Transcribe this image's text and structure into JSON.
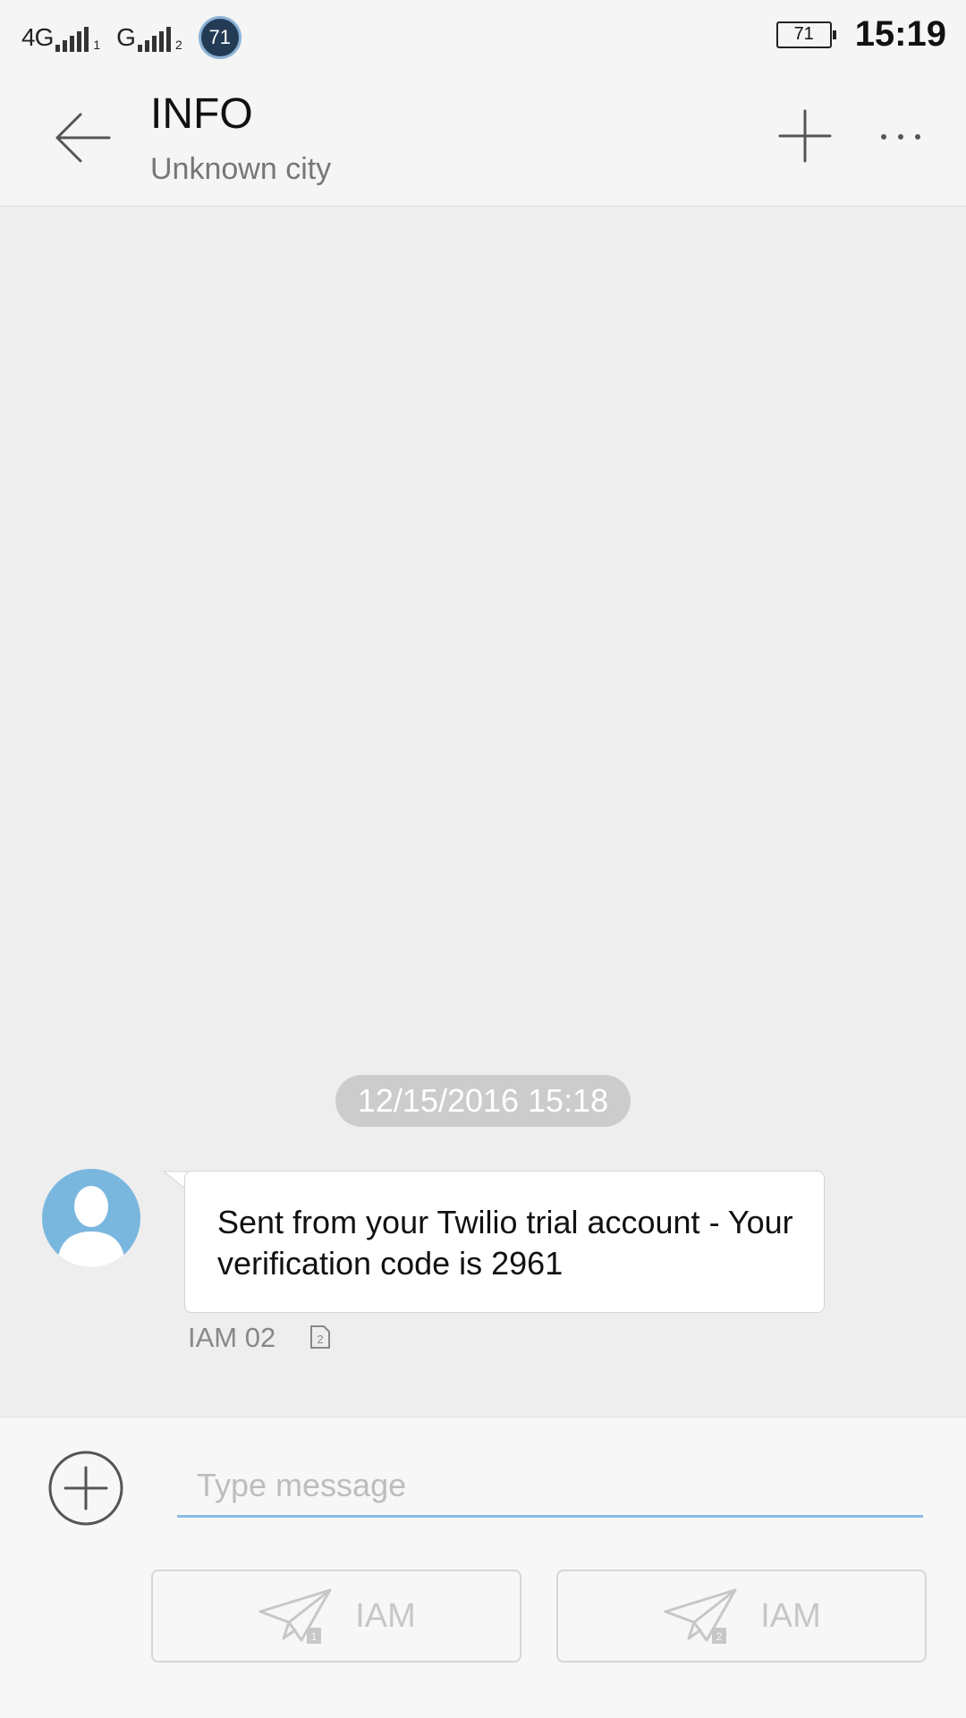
{
  "status_bar": {
    "sim1_network": "4G",
    "sim1_index": "1",
    "sim2_network": "G",
    "sim2_index": "2",
    "notification_badge": "71",
    "battery_level": "71",
    "time": "15:19"
  },
  "header": {
    "title": "INFO",
    "subtitle": "Unknown city",
    "icons": {
      "back": "back-arrow-icon",
      "add": "plus-icon",
      "more": "more-dots-icon"
    }
  },
  "conversation": {
    "timestamp": "12/15/2016 15:18",
    "message": {
      "text": "Sent from your Twilio trial account - Your verification code is 2961",
      "sender_line": "IAM 02",
      "sim_badge": "2"
    }
  },
  "composer": {
    "placeholder": "Type message",
    "send_sim1": {
      "label": "IAM",
      "sim": "1"
    },
    "send_sim2": {
      "label": "IAM",
      "sim": "2"
    }
  },
  "colors": {
    "background": "#eeeeee",
    "input_underline": "#8bbbe3",
    "avatar": "#79b7df"
  }
}
